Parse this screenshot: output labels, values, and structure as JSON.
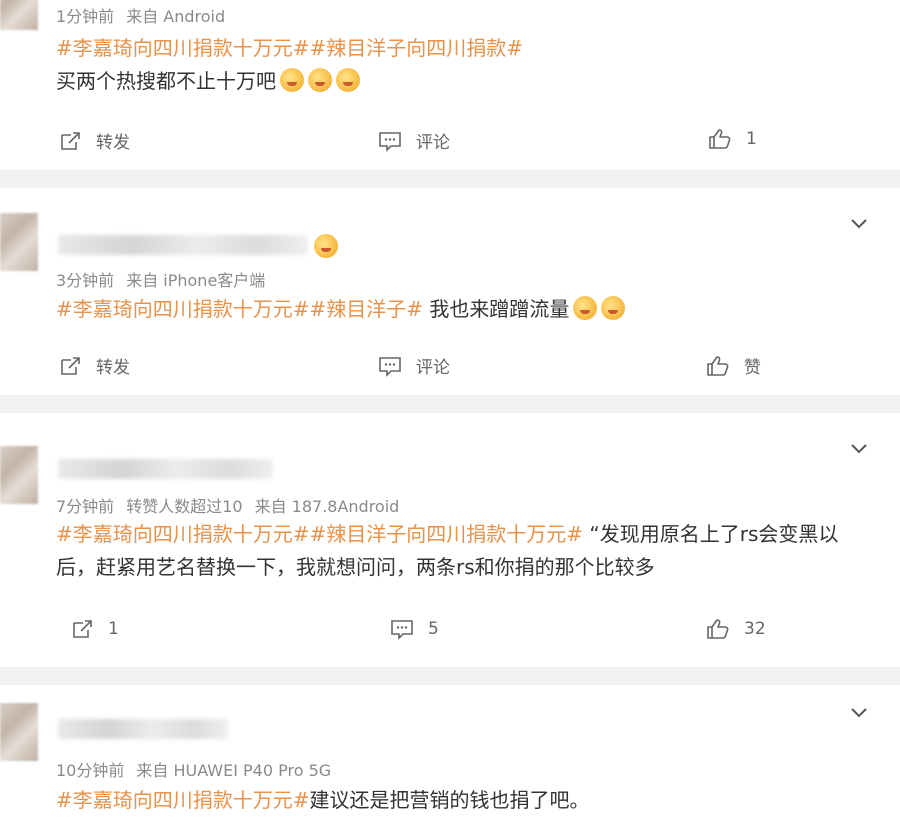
{
  "posts": [
    {
      "meta": {
        "time": "1分钟前",
        "source": "来自 Android"
      },
      "tags": "#李嘉琦向四川捐款十万元##辣目洋子向四川捐款#",
      "text": "买两个热搜都不止十万吧",
      "actions": {
        "repost": "转发",
        "comment": "评论",
        "like": "1"
      }
    },
    {
      "meta": {
        "time": "3分钟前",
        "source": "来自 iPhone客户端"
      },
      "tags": "#李嘉琦向四川捐款十万元##辣目洋子#",
      "text": " 我也来蹭蹭流量",
      "actions": {
        "repost": "转发",
        "comment": "评论",
        "like": "赞"
      }
    },
    {
      "meta": {
        "time": "7分钟前",
        "extra": "转赞人数超过10",
        "source": "来自 187.8Android"
      },
      "tags": "#李嘉琦向四川捐款十万元##辣目洋子向四川捐款十万元#",
      "text": " “发现用原名上了rs会变黑以后，赶紧用艺名替换一下，我就想问问，两条rs和你捐的那个比较多",
      "actions": {
        "repost": "1",
        "comment": "5",
        "like": "32"
      }
    },
    {
      "meta": {
        "time": "10分钟前",
        "source": "来自 HUAWEI P40 Pro 5G"
      },
      "tags": "#李嘉琦向四川捐款十万元#",
      "text": "建议还是把营销的钱也捐了吧。"
    }
  ]
}
